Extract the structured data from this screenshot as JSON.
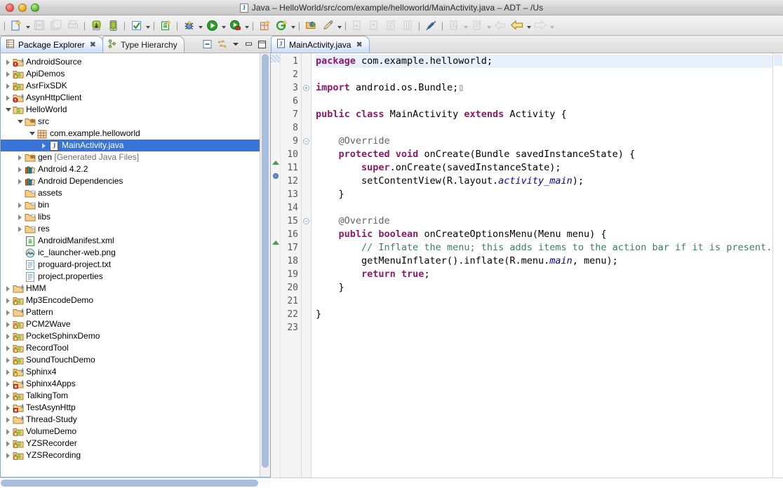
{
  "window": {
    "title": "Java – HelloWorld/src/com/example/helloworld/MainActivity.java – ADT – /Us",
    "app_icon": "java-file-icon"
  },
  "toolbar": {
    "groups": [
      {
        "name": "new-group",
        "items": [
          {
            "name": "new-wizard-button",
            "icon": "new-document-icon",
            "dropdown": true,
            "enabled": true
          },
          {
            "name": "save-button",
            "icon": "save-icon",
            "dropdown": false,
            "enabled": false
          },
          {
            "name": "save-all-button",
            "icon": "save-all-icon",
            "dropdown": false,
            "enabled": false
          },
          {
            "name": "print-button",
            "icon": "print-icon",
            "dropdown": false,
            "enabled": false
          }
        ]
      },
      {
        "name": "android-group",
        "items": [
          {
            "name": "android-sdk-manager-button",
            "icon": "android-download-icon",
            "dropdown": false,
            "enabled": true
          },
          {
            "name": "android-avd-manager-button",
            "icon": "android-device-icon",
            "dropdown": false,
            "enabled": true
          }
        ]
      },
      {
        "name": "build-group",
        "items": [
          {
            "name": "build-check-button",
            "icon": "checkbox-check-icon",
            "dropdown": true,
            "enabled": true
          }
        ]
      },
      {
        "name": "new-android-group",
        "items": [
          {
            "name": "new-android-project-button",
            "icon": "android-new-icon",
            "dropdown": false,
            "enabled": true
          }
        ]
      },
      {
        "name": "run-group",
        "items": [
          {
            "name": "debug-button",
            "icon": "bug-icon",
            "dropdown": true,
            "enabled": true
          },
          {
            "name": "run-button",
            "icon": "run-play-icon",
            "dropdown": true,
            "enabled": true
          },
          {
            "name": "external-tools-button",
            "icon": "run-external-icon",
            "dropdown": true,
            "enabled": true
          }
        ]
      },
      {
        "name": "perspective-group",
        "items": [
          {
            "name": "new-package-button",
            "icon": "new-package-icon",
            "dropdown": false,
            "enabled": true
          },
          {
            "name": "new-class-button",
            "icon": "new-class-icon",
            "dropdown": true,
            "enabled": true
          }
        ]
      },
      {
        "name": "search-group",
        "items": [
          {
            "name": "open-type-button",
            "icon": "open-folder-icon",
            "dropdown": false,
            "enabled": true
          },
          {
            "name": "search-button",
            "icon": "pencil-search-icon",
            "dropdown": true,
            "enabled": true
          }
        ]
      },
      {
        "name": "nav-group",
        "items": [
          {
            "name": "previous-annotation-button",
            "icon": "prev-annotation-icon",
            "dropdown": false,
            "enabled": false
          },
          {
            "name": "next-annotation-button",
            "icon": "next-annotation-icon",
            "dropdown": false,
            "enabled": false
          },
          {
            "name": "toggle-mark-occurrences-button",
            "icon": "mark-occurrences-icon",
            "dropdown": false,
            "enabled": false
          },
          {
            "name": "toggle-block-selection-button",
            "icon": "block-selection-icon",
            "dropdown": false,
            "enabled": false
          }
        ]
      },
      {
        "name": "occurrences-group",
        "items": [
          {
            "name": "mark-occurrences-toggle",
            "icon": "pen-strike-icon",
            "dropdown": false,
            "enabled": true
          }
        ]
      },
      {
        "name": "history-group",
        "items": [
          {
            "name": "next-edit-button",
            "icon": "next-edit-icon",
            "dropdown": true,
            "enabled": false
          },
          {
            "name": "prev-edit-button",
            "icon": "prev-edit-icon",
            "dropdown": true,
            "enabled": false
          },
          {
            "name": "back-history-disabled",
            "icon": "back-arrow-icon",
            "dropdown": false,
            "enabled": false
          },
          {
            "name": "back-button",
            "icon": "back-arrow-icon",
            "dropdown": true,
            "enabled": true
          },
          {
            "name": "forward-button",
            "icon": "forward-arrow-icon",
            "dropdown": true,
            "enabled": false
          }
        ]
      }
    ]
  },
  "left_panel": {
    "tabs": [
      {
        "label": "Package Explorer",
        "icon": "package-explorer-icon",
        "active": true,
        "closable": true
      },
      {
        "label": "Type Hierarchy",
        "icon": "type-hierarchy-icon",
        "active": false,
        "closable": false
      }
    ],
    "view_actions": [
      {
        "name": "collapse-all-button",
        "icon": "collapse-all-icon"
      },
      {
        "name": "link-with-editor-button",
        "icon": "link-editor-icon"
      },
      {
        "name": "view-menu-button",
        "icon": "chevron-down-icon"
      },
      {
        "name": "minimize-view-button",
        "icon": "minimize-icon"
      },
      {
        "name": "maximize-view-button",
        "icon": "maximize-icon"
      }
    ],
    "tree": [
      {
        "label": "AndroidSource",
        "indent": 0,
        "twisty": "closed",
        "icon": "java-project-warn-icon"
      },
      {
        "label": "ApiDemos",
        "indent": 0,
        "twisty": "closed",
        "icon": "android-project-lock-icon"
      },
      {
        "label": "AsrFixSDK",
        "indent": 0,
        "twisty": "closed",
        "icon": "android-project-lock-icon"
      },
      {
        "label": "AsynHttpClient",
        "indent": 0,
        "twisty": "closed",
        "icon": "java-project-warn-icon"
      },
      {
        "label": "HelloWorld",
        "indent": 0,
        "twisty": "open",
        "icon": "android-project-icon"
      },
      {
        "label": "src",
        "indent": 1,
        "twisty": "open",
        "icon": "source-folder-icon"
      },
      {
        "label": "com.example.helloworld",
        "indent": 2,
        "twisty": "open",
        "icon": "package-icon"
      },
      {
        "label": "MainActivity.java",
        "indent": 3,
        "twisty": "closed",
        "icon": "java-file-icon",
        "selected": true
      },
      {
        "label": "gen",
        "suffix": " [Generated Java Files]",
        "indent": 1,
        "twisty": "closed",
        "icon": "source-folder-icon"
      },
      {
        "label": "Android 4.2.2",
        "indent": 1,
        "twisty": "closed",
        "icon": "library-icon"
      },
      {
        "label": "Android Dependencies",
        "indent": 1,
        "twisty": "closed",
        "icon": "library-icon"
      },
      {
        "label": "assets",
        "indent": 1,
        "twisty": "none",
        "icon": "folder-icon"
      },
      {
        "label": "bin",
        "indent": 1,
        "twisty": "closed",
        "icon": "folder-icon"
      },
      {
        "label": "libs",
        "indent": 1,
        "twisty": "closed",
        "icon": "folder-icon"
      },
      {
        "label": "res",
        "indent": 1,
        "twisty": "closed",
        "icon": "folder-icon"
      },
      {
        "label": "AndroidManifest.xml",
        "indent": 1,
        "twisty": "none",
        "icon": "android-xml-icon"
      },
      {
        "label": "ic_launcher-web.png",
        "indent": 1,
        "twisty": "none",
        "icon": "image-file-icon"
      },
      {
        "label": "proguard-project.txt",
        "indent": 1,
        "twisty": "none",
        "icon": "text-file-icon"
      },
      {
        "label": "project.properties",
        "indent": 1,
        "twisty": "none",
        "icon": "text-file-icon"
      },
      {
        "label": "HMM",
        "indent": 0,
        "twisty": "closed",
        "icon": "java-project-icon"
      },
      {
        "label": "Mp3EncodeDemo",
        "indent": 0,
        "twisty": "closed",
        "icon": "android-project-lock-icon"
      },
      {
        "label": "Pattern",
        "indent": 0,
        "twisty": "closed",
        "icon": "java-project-icon"
      },
      {
        "label": "PCM2Wave",
        "indent": 0,
        "twisty": "closed",
        "icon": "android-project-lock-icon"
      },
      {
        "label": "PocketSphinxDemo",
        "indent": 0,
        "twisty": "closed",
        "icon": "android-project-lock-icon"
      },
      {
        "label": "RecordTool",
        "indent": 0,
        "twisty": "closed",
        "icon": "android-project-lock-icon"
      },
      {
        "label": "SoundTouchDemo",
        "indent": 0,
        "twisty": "closed",
        "icon": "android-project-lock-icon"
      },
      {
        "label": "Sphinx4",
        "indent": 0,
        "twisty": "closed",
        "icon": "java-project-lock-icon"
      },
      {
        "label": "Sphinx4Apps",
        "indent": 0,
        "twisty": "closed",
        "icon": "java-project-error-icon"
      },
      {
        "label": "TalkingTom",
        "indent": 0,
        "twisty": "closed",
        "icon": "android-project-lock-icon"
      },
      {
        "label": "TestAsynHttp",
        "indent": 0,
        "twisty": "closed",
        "icon": "java-project-error-icon"
      },
      {
        "label": "Thread-Study",
        "indent": 0,
        "twisty": "closed",
        "icon": "java-project-icon"
      },
      {
        "label": "VolumeDemo",
        "indent": 0,
        "twisty": "closed",
        "icon": "android-project-lock-icon"
      },
      {
        "label": "YZSRecorder",
        "indent": 0,
        "twisty": "closed",
        "icon": "android-project-lock-icon"
      },
      {
        "label": "YZSRecording",
        "indent": 0,
        "twisty": "closed",
        "icon": "android-project-lock-icon"
      }
    ]
  },
  "editor": {
    "tabs": [
      {
        "label": "MainActivity.java",
        "icon": "java-file-icon",
        "active": true,
        "closable": true
      }
    ],
    "lines": [
      {
        "num": "1",
        "marker": "none",
        "fold": "none",
        "highlight": true,
        "tokens": [
          {
            "t": "package ",
            "c": "kw"
          },
          {
            "t": "com.example.helloworld;",
            "c": ""
          }
        ]
      },
      {
        "num": "2",
        "marker": "none",
        "fold": "none",
        "tokens": []
      },
      {
        "num": "3",
        "marker": "none",
        "fold": "plus",
        "tokens": [
          {
            "t": "import ",
            "c": "kw"
          },
          {
            "t": "android.os.Bundle;",
            "c": ""
          },
          {
            "t": "▯",
            "c": "anno"
          }
        ]
      },
      {
        "num": "6",
        "marker": "none",
        "fold": "none",
        "tokens": []
      },
      {
        "num": "7",
        "marker": "none",
        "fold": "none",
        "tokens": [
          {
            "t": "public class ",
            "c": "kw"
          },
          {
            "t": "MainActivity ",
            "c": ""
          },
          {
            "t": "extends ",
            "c": "kw"
          },
          {
            "t": "Activity {",
            "c": ""
          }
        ]
      },
      {
        "num": "8",
        "marker": "none",
        "fold": "none",
        "tokens": []
      },
      {
        "num": "9",
        "marker": "none",
        "fold": "minus",
        "tokens": [
          {
            "t": "    @Override",
            "c": "anno"
          }
        ]
      },
      {
        "num": "10",
        "marker": "override",
        "fold": "none",
        "tokens": [
          {
            "t": "    ",
            "c": ""
          },
          {
            "t": "protected void ",
            "c": "kw"
          },
          {
            "t": "onCreate(Bundle savedInstanceState) {",
            "c": ""
          }
        ]
      },
      {
        "num": "11",
        "marker": "breakpoint",
        "fold": "none",
        "tokens": [
          {
            "t": "        ",
            "c": ""
          },
          {
            "t": "super",
            "c": "kw"
          },
          {
            "t": ".onCreate(savedInstanceState);",
            "c": ""
          }
        ]
      },
      {
        "num": "12",
        "marker": "none",
        "fold": "none",
        "tokens": [
          {
            "t": "        setContentView(R.layout.",
            "c": ""
          },
          {
            "t": "activity_main",
            "c": "fld"
          },
          {
            "t": ");",
            "c": ""
          }
        ]
      },
      {
        "num": "13",
        "marker": "none",
        "fold": "none",
        "tokens": [
          {
            "t": "    }",
            "c": ""
          }
        ]
      },
      {
        "num": "14",
        "marker": "none",
        "fold": "none",
        "tokens": []
      },
      {
        "num": "15",
        "marker": "none",
        "fold": "minus",
        "tokens": [
          {
            "t": "    @Override",
            "c": "anno"
          }
        ]
      },
      {
        "num": "16",
        "marker": "override",
        "fold": "none",
        "tokens": [
          {
            "t": "    ",
            "c": ""
          },
          {
            "t": "public boolean ",
            "c": "kw"
          },
          {
            "t": "onCreateOptionsMenu(Menu menu) {",
            "c": ""
          }
        ]
      },
      {
        "num": "17",
        "marker": "none",
        "fold": "none",
        "tokens": [
          {
            "t": "        // Inflate the menu; this adds items to the action bar if it is present.",
            "c": "cm"
          }
        ]
      },
      {
        "num": "18",
        "marker": "none",
        "fold": "none",
        "tokens": [
          {
            "t": "        getMenuInflater().inflate(R.menu.",
            "c": ""
          },
          {
            "t": "main",
            "c": "fld"
          },
          {
            "t": ", menu);",
            "c": ""
          }
        ]
      },
      {
        "num": "19",
        "marker": "none",
        "fold": "none",
        "tokens": [
          {
            "t": "        ",
            "c": ""
          },
          {
            "t": "return true",
            "c": "kw"
          },
          {
            "t": ";",
            "c": ""
          }
        ]
      },
      {
        "num": "20",
        "marker": "none",
        "fold": "none",
        "tokens": [
          {
            "t": "    }",
            "c": ""
          }
        ]
      },
      {
        "num": "21",
        "marker": "none",
        "fold": "none",
        "tokens": []
      },
      {
        "num": "22",
        "marker": "none",
        "fold": "none",
        "tokens": [
          {
            "t": "}",
            "c": ""
          }
        ]
      },
      {
        "num": "23",
        "marker": "none",
        "fold": "none",
        "tokens": []
      }
    ]
  },
  "colors": {
    "selection_blue": "#3875d7",
    "keyword_purple": "#8b1a6b",
    "comment_green": "#3f7f5f",
    "field_blue": "#0000c0",
    "current_line": "#e8f0fb"
  }
}
